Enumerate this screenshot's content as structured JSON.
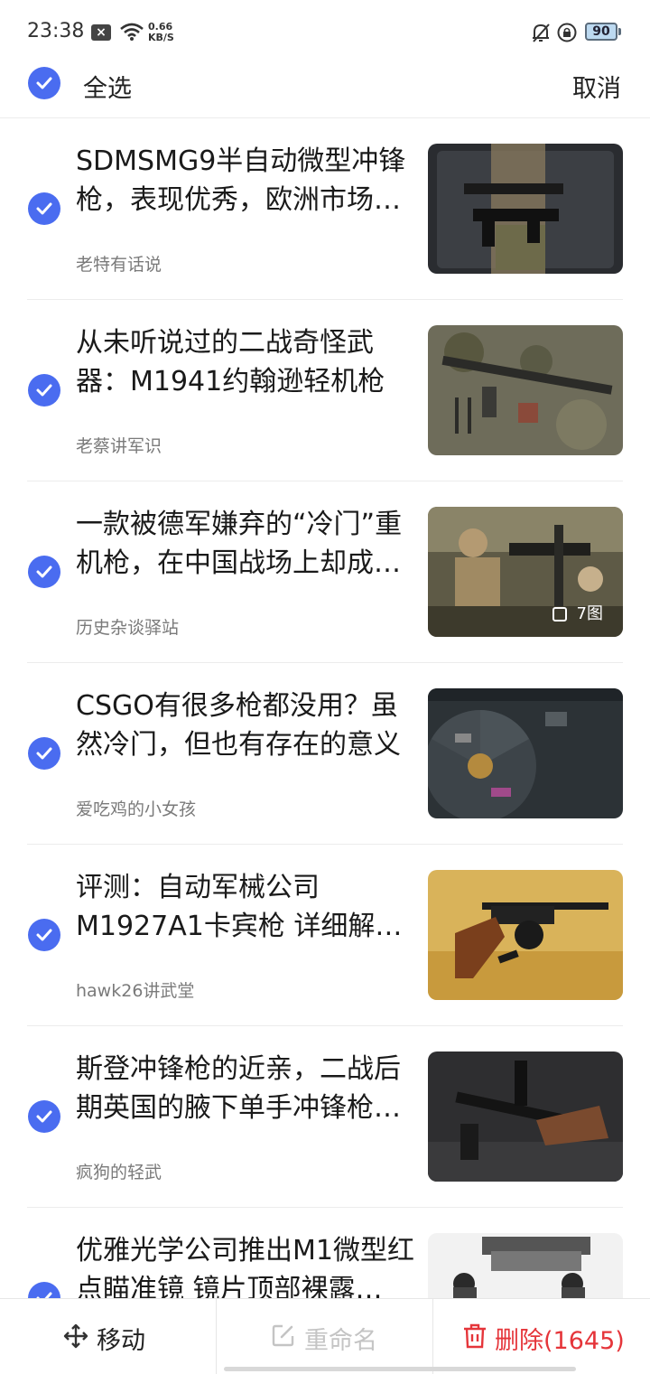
{
  "status_bar": {
    "time": "23:38",
    "net_speed_value": "0.66",
    "net_speed_unit": "KB/S",
    "battery": "90",
    "icons": [
      "close-box-icon",
      "wifi-icon",
      "bell-off-icon",
      "lock-rotation-icon",
      "battery-icon"
    ]
  },
  "header": {
    "select_all_label": "全选",
    "cancel_label": "取消",
    "accent_color": "#4a6cf0"
  },
  "items": [
    {
      "title": "SDMSMG9半自动微型冲锋枪，表现优秀，欧洲市场…",
      "source": "老特有话说",
      "selected": true,
      "image_count": ""
    },
    {
      "title": "从未听说过的二战奇怪武器：M1941约翰逊轻机枪",
      "source": "老蔡讲军识",
      "selected": true,
      "image_count": ""
    },
    {
      "title": "一款被德军嫌弃的“冷门”重机枪，在中国战场上却成…",
      "source": "历史杂谈驿站",
      "selected": true,
      "image_count": "7图"
    },
    {
      "title": "CSGO有很多枪都没用？虽然冷门，但也有存在的意义",
      "source": "爱吃鸡的小女孩",
      "selected": true,
      "image_count": ""
    },
    {
      "title": "评测：自动军械公司M1927A1卡宾枪 详细解…",
      "source": "hawk26讲武堂",
      "selected": true,
      "image_count": ""
    },
    {
      "title": "斯登冲锋枪的近亲，二战后期英国的腋下单手冲锋枪…",
      "source": "疯狗的轻武",
      "selected": true,
      "image_count": ""
    },
    {
      "title": "优雅光学公司推出M1微型红点瞄准镜 镜片顶部裸露…",
      "source": "",
      "selected": true,
      "image_count": ""
    }
  ],
  "toolbar": {
    "move_label": "移动",
    "rename_label": "重命名",
    "delete_label": "删除(1645)",
    "delete_color": "#e5353a",
    "disabled_color": "#c4c4c4"
  }
}
